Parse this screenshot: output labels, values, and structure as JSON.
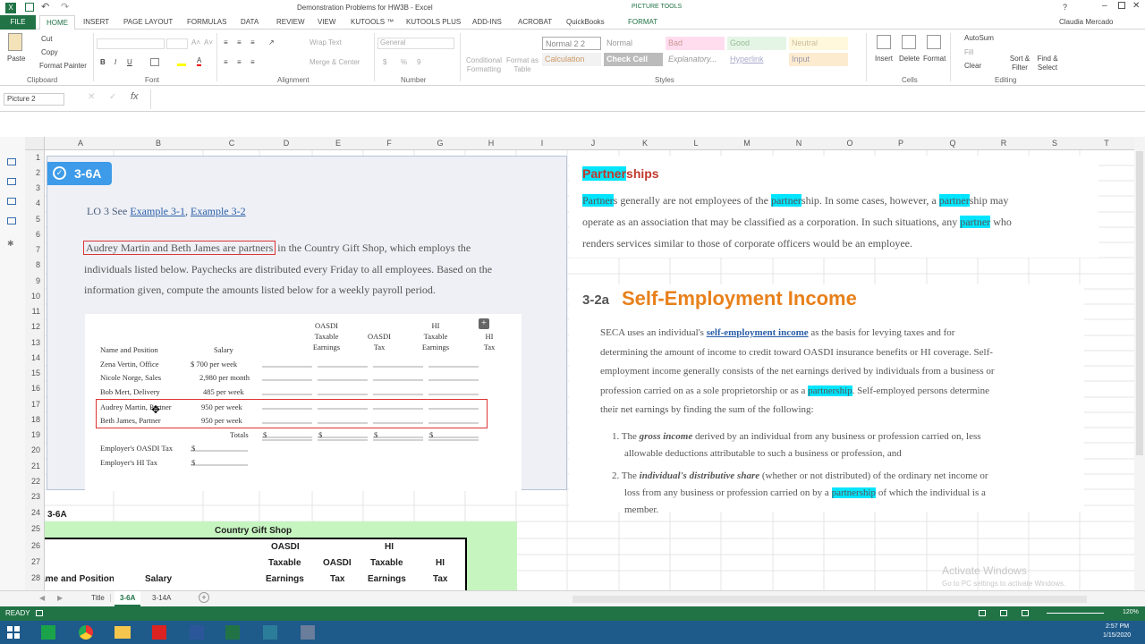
{
  "window": {
    "title": "Demonstration Problems for HW3B - Excel",
    "context_tab": "PICTURE TOOLS",
    "user": "Claudia Mercado",
    "qat_redo": "+"
  },
  "tabs": [
    "FILE",
    "HOME",
    "INSERT",
    "PAGE LAYOUT",
    "FORMULAS",
    "DATA",
    "REVIEW",
    "VIEW",
    "KUTOOLS ™",
    "KUTOOLS PLUS",
    "ADD-INS",
    "ACROBAT",
    "QuickBooks",
    "FORMAT"
  ],
  "ribbon": {
    "clipboard": {
      "paste": "Paste",
      "cut": "Cut",
      "copy": "Copy",
      "format_painter": "Format Painter",
      "label": "Clipboard"
    },
    "font": {
      "label": "Font",
      "bold": "B",
      "italic": "I",
      "underline": "U",
      "grow": "A˄",
      "shrink": "A˅",
      "font_color": "A"
    },
    "alignment": {
      "wrap": "Wrap Text",
      "merge": "Merge & Center",
      "label": "Alignment"
    },
    "number": {
      "format": "General",
      "currency": "$",
      "percent": "%",
      "comma": "9",
      "label": "Number"
    },
    "styles": {
      "conditional": "Conditional Formatting",
      "format_as": "Format as Table",
      "cells": [
        "Normal 2 2",
        "Normal",
        "Bad",
        "Good",
        "Neutral",
        "Calculation",
        "Check Cell",
        "Explanatory...",
        "Hyperlink",
        "Input"
      ],
      "label": "Styles"
    },
    "cells": {
      "insert": "Insert",
      "delete": "Delete",
      "format": "Format",
      "label": "Cells"
    },
    "editing": {
      "autosum": "AutoSum",
      "fill": "Fill",
      "clear": "Clear",
      "sort": "Sort & Filter",
      "find": "Find & Select",
      "label": "Editing"
    }
  },
  "formula_bar": {
    "name_box": "Picture 2",
    "fx": "fx",
    "value": ""
  },
  "columns": [
    "A",
    "B",
    "C",
    "D",
    "E",
    "F",
    "G",
    "H",
    "I",
    "J",
    "K",
    "L",
    "M",
    "N",
    "O",
    "P",
    "Q",
    "R",
    "S",
    "T"
  ],
  "rows": [
    "1",
    "2",
    "3",
    "4",
    "5",
    "6",
    "7",
    "8",
    "9",
    "10",
    "11",
    "12",
    "13",
    "14",
    "15",
    "16",
    "17",
    "18",
    "19",
    "20",
    "21",
    "22",
    "23",
    "24",
    "25",
    "26",
    "27",
    "28"
  ],
  "problem": {
    "badge": "3-6A",
    "lo": "LO 3  See ",
    "ex1": "Example 3-1",
    "comma": ", ",
    "ex2": "Example 3-2",
    "intro_boxed": "Audrey Martin and Beth James are partners",
    "intro_line1_rest": " in the Country Gift Shop, which employs the",
    "intro_line2": "individuals listed below. Paychecks are distributed every Friday to all employees. Based on the",
    "intro_line3": "information given, compute the amounts listed below for a weekly payroll period.",
    "table": {
      "h_name": "Name and Position",
      "h_salary": "Salary",
      "h_oasdi_taxable": [
        "OASDI",
        "Taxable",
        "Earnings"
      ],
      "h_oasdi_tax": [
        "OASDI",
        "Tax"
      ],
      "h_hi_taxable": [
        "HI",
        "Taxable",
        "Earnings"
      ],
      "h_hi_tax": [
        "HI",
        "Tax"
      ],
      "rows": [
        {
          "name": "Zena Vertin, Office",
          "salary": "$   700 per week"
        },
        {
          "name": "Nicole Norge, Sales",
          "salary": "2,980 per month"
        },
        {
          "name": "Bob Mert, Delivery",
          "salary": "485 per week"
        },
        {
          "name": "Audrey Martin, Partner",
          "salary": "950 per week"
        },
        {
          "name": "Beth James, Partner",
          "salary": "950 per week"
        }
      ],
      "totals": "Totals",
      "dollar": "$",
      "emp_oasdi": "Employer's OASDI Tax",
      "emp_hi": "Employer's HI Tax"
    }
  },
  "partnerships": {
    "title_hl": "Partner",
    "title_rest": "ships",
    "p1_a": "Partner",
    "p1_b": "s generally are not employees of the ",
    "p1_c": "partner",
    "p1_d": "ship. In some cases, however, a ",
    "p1_e": "partner",
    "p1_f": "ship may",
    "p2_a": "operate as an association that may be classified as a corporation. In such situations, any ",
    "p2_b": "partner",
    "p2_c": " who",
    "p3": "renders services similar to those of corporate officers would be an employee."
  },
  "seca": {
    "num": "3-2a",
    "title": "Self-Employment Income",
    "l1_a": "SECA uses an individual's ",
    "l1_b": "self-employment income",
    "l1_c": " as the basis for levying taxes and for",
    "l2": "determining the amount of income to credit toward OASDI insurance benefits or HI coverage. Self-",
    "l3": "employment income generally consists of the net earnings derived by individuals from a business or",
    "l4_a": "profession carried on as a sole proprietorship or as a ",
    "l4_b": "partnership",
    "l4_c": ". Self-employed persons determine",
    "l5": "their net earnings by finding the sum of the following:",
    "i1_n": "1. The ",
    "i1_b": "gross income",
    "i1_c": " derived by an individual from any business or profession carried on, less",
    "i1_d": "allowable deductions attributable to such a business or profession, and",
    "i2_n": "2. The ",
    "i2_b": "individual's distributive share",
    "i2_c": " (whether or not distributed) of the ordinary net income or",
    "i2_d": "loss from any business or profession carried on by a ",
    "i2_e": "partnership",
    "i2_f": " of which the individual is a",
    "i2_g": "member."
  },
  "cells": {
    "a24": "3-6A",
    "shop": "Country Gift Shop",
    "oasdi1": "OASDI",
    "hi1": "HI",
    "taxable": "Taxable",
    "oasdi2": "OASDI",
    "taxable2": "Taxable",
    "hi2": "HI",
    "name_pos": "Name and Position",
    "salary": "Salary",
    "earnings": "Earnings",
    "tax": "Tax",
    "earnings2": "Earnings",
    "tax2": "Tax"
  },
  "watermark": {
    "line1": "Activate Windows",
    "line2": "Go to PC settings to activate Windows."
  },
  "sheets": [
    "Title",
    "3-6A",
    "3-14A"
  ],
  "status": {
    "ready": "READY",
    "zoom": "120%"
  },
  "clock": {
    "time": "2:57 PM",
    "date": "1/15/2020"
  },
  "colors": {
    "excel_green": "#217346",
    "highlight": "#00e5ff",
    "badge": "#3d9be9",
    "seca_orange": "#e8801a",
    "partner_red": "#c0392b",
    "green_band": "#c6f5c0"
  }
}
